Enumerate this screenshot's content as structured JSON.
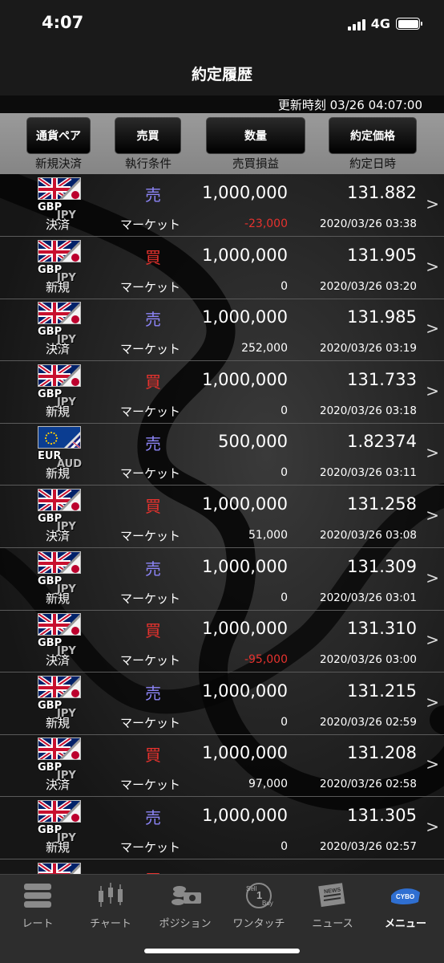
{
  "status": {
    "time": "4:07",
    "network": "4G"
  },
  "page": {
    "title": "約定履歴"
  },
  "update": {
    "text": "更新時刻 03/26 04:07:00"
  },
  "header": {
    "buttons": [
      "通貨ペア",
      "売買",
      "数量",
      "約定価格"
    ],
    "subs": [
      "新規決済",
      "執行条件",
      "売買損益",
      "約定日時"
    ]
  },
  "trades": [
    {
      "base": "GBP",
      "quote": "JPY",
      "kind": "決済",
      "side": "売",
      "side_type": "sell",
      "condition": "マーケット",
      "qty": "1,000,000",
      "pnl": "-23,000",
      "pnl_neg": true,
      "price": "131.882",
      "date": "2020/03/26 03:38"
    },
    {
      "base": "GBP",
      "quote": "JPY",
      "kind": "新規",
      "side": "買",
      "side_type": "buy",
      "condition": "マーケット",
      "qty": "1,000,000",
      "pnl": "0",
      "pnl_neg": false,
      "price": "131.905",
      "date": "2020/03/26 03:20"
    },
    {
      "base": "GBP",
      "quote": "JPY",
      "kind": "決済",
      "side": "売",
      "side_type": "sell",
      "condition": "マーケット",
      "qty": "1,000,000",
      "pnl": "252,000",
      "pnl_neg": false,
      "price": "131.985",
      "date": "2020/03/26 03:19"
    },
    {
      "base": "GBP",
      "quote": "JPY",
      "kind": "新規",
      "side": "買",
      "side_type": "buy",
      "condition": "マーケット",
      "qty": "1,000,000",
      "pnl": "0",
      "pnl_neg": false,
      "price": "131.733",
      "date": "2020/03/26 03:18"
    },
    {
      "base": "EUR",
      "quote": "AUD",
      "kind": "新規",
      "side": "売",
      "side_type": "sell",
      "condition": "マーケット",
      "qty": "500,000",
      "pnl": "0",
      "pnl_neg": false,
      "price": "1.82374",
      "date": "2020/03/26 03:11"
    },
    {
      "base": "GBP",
      "quote": "JPY",
      "kind": "決済",
      "side": "買",
      "side_type": "buy",
      "condition": "マーケット",
      "qty": "1,000,000",
      "pnl": "51,000",
      "pnl_neg": false,
      "price": "131.258",
      "date": "2020/03/26 03:08"
    },
    {
      "base": "GBP",
      "quote": "JPY",
      "kind": "新規",
      "side": "売",
      "side_type": "sell",
      "condition": "マーケット",
      "qty": "1,000,000",
      "pnl": "0",
      "pnl_neg": false,
      "price": "131.309",
      "date": "2020/03/26 03:01"
    },
    {
      "base": "GBP",
      "quote": "JPY",
      "kind": "決済",
      "side": "買",
      "side_type": "buy",
      "condition": "マーケット",
      "qty": "1,000,000",
      "pnl": "-95,000",
      "pnl_neg": true,
      "price": "131.310",
      "date": "2020/03/26 03:00"
    },
    {
      "base": "GBP",
      "quote": "JPY",
      "kind": "新規",
      "side": "売",
      "side_type": "sell",
      "condition": "マーケット",
      "qty": "1,000,000",
      "pnl": "0",
      "pnl_neg": false,
      "price": "131.215",
      "date": "2020/03/26 02:59"
    },
    {
      "base": "GBP",
      "quote": "JPY",
      "kind": "決済",
      "side": "買",
      "side_type": "buy",
      "condition": "マーケット",
      "qty": "1,000,000",
      "pnl": "97,000",
      "pnl_neg": false,
      "price": "131.208",
      "date": "2020/03/26 02:58"
    },
    {
      "base": "GBP",
      "quote": "JPY",
      "kind": "新規",
      "side": "売",
      "side_type": "sell",
      "condition": "マーケット",
      "qty": "1,000,000",
      "pnl": "0",
      "pnl_neg": false,
      "price": "131.305",
      "date": "2020/03/26 02:57"
    },
    {
      "base": "GBP",
      "quote": "JPY",
      "kind": "",
      "side": "買",
      "side_type": "buy",
      "condition": "",
      "qty": "",
      "pnl": "",
      "pnl_neg": false,
      "price": "",
      "date": ""
    }
  ],
  "tabs": [
    {
      "label": "レート",
      "icon": "rate-icon",
      "active": false
    },
    {
      "label": "チャート",
      "icon": "chart-icon",
      "active": false
    },
    {
      "label": "ポジション",
      "icon": "position-icon",
      "active": false
    },
    {
      "label": "ワンタッチ",
      "icon": "one-touch-icon",
      "active": false,
      "sell_text": "Sell",
      "buy_text": "Buy",
      "num_text": "1"
    },
    {
      "label": "ニュース",
      "icon": "news-icon",
      "active": false,
      "news_text": "NEWS"
    },
    {
      "label": "メニュー",
      "icon": "menu-icon",
      "active": true,
      "logo_text": "CYBO"
    }
  ],
  "colors": {
    "sell": "#8c84f6",
    "buy": "#e6322e",
    "negative": "#e6322e"
  }
}
